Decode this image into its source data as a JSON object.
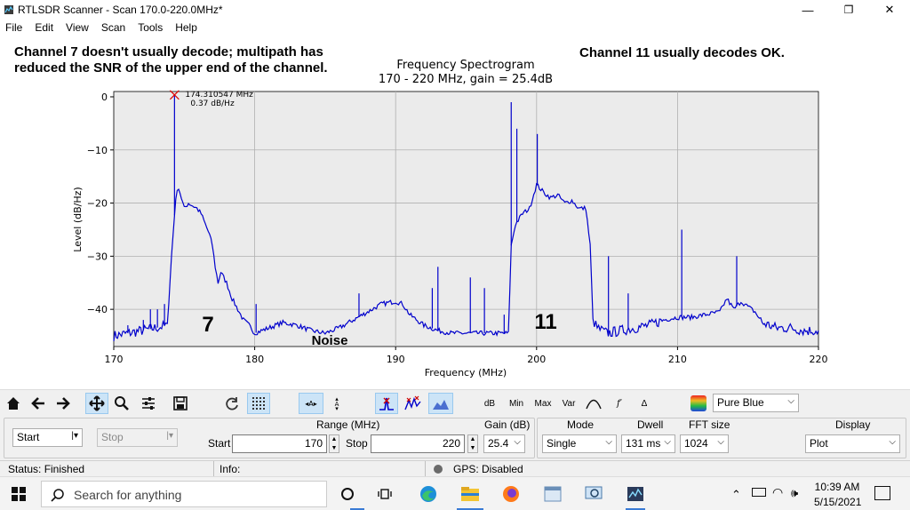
{
  "window": {
    "title": "RTLSDR Scanner - Scan 170.0-220.0MHz*",
    "minimize": "—",
    "maximize": "❐",
    "close": "✕"
  },
  "menu": [
    "File",
    "Edit",
    "View",
    "Scan",
    "Tools",
    "Help"
  ],
  "annotations": {
    "left_line1": "Channel 7 doesn't usually decode; multipath has",
    "left_line2": "reduced the SNR of the upper end of the channel.",
    "right": "Channel 11 usually decodes OK.",
    "ch7": "7",
    "ch11": "11",
    "noise": "Noise"
  },
  "chart_data": {
    "type": "line",
    "title": "Frequency Spectrogram",
    "subtitle": "170 - 220 MHz, gain = 25.4dB",
    "xlabel": "Frequency (MHz)",
    "ylabel": "Level (dB/Hz)",
    "xlim": [
      170,
      220
    ],
    "ylim": [
      -47,
      1
    ],
    "xticks": [
      "170",
      "180",
      "190",
      "200",
      "210",
      "220"
    ],
    "yticks": [
      "0",
      "−10",
      "−20",
      "−30",
      "−40"
    ],
    "grid": true,
    "color": "#0000cc",
    "marker": {
      "x": 174.310547,
      "y": 0.37,
      "label1": "174.310547 MHz",
      "label2": "0.37 dB/Hz"
    },
    "x": [
      170,
      171,
      172,
      173,
      173.8,
      174.1,
      174.4,
      174.6,
      174.8,
      175,
      175.3,
      175.6,
      175.9,
      176.2,
      176.5,
      176.8,
      177,
      177.2,
      177.4,
      177.6,
      178,
      178.4,
      178.8,
      179.2,
      179.6,
      180,
      181,
      182,
      183,
      184,
      185,
      186,
      187,
      188,
      189,
      190,
      190.5,
      191,
      192,
      193,
      194,
      195,
      196,
      197,
      198,
      198.2,
      198.5,
      199,
      199.5,
      200,
      200.5,
      201,
      201.5,
      202,
      202.5,
      203,
      203.5,
      203.8,
      204,
      204.3,
      205,
      206,
      207,
      208,
      209,
      210,
      211,
      212,
      213,
      213.5,
      214,
      214.5,
      215,
      215.5,
      216,
      217,
      218,
      219,
      220
    ],
    "y": [
      -45,
      -44.5,
      -44,
      -43.5,
      -43,
      -30,
      -19,
      -17,
      -19,
      -21,
      -20,
      -20.5,
      -21,
      -22,
      -24,
      -26,
      -28,
      -32,
      -35,
      -33,
      -35,
      -38,
      -40,
      -42,
      -43,
      -44.5,
      -43.5,
      -42.5,
      -43,
      -44,
      -44.5,
      -43.5,
      -42,
      -40.5,
      -39,
      -38.5,
      -39,
      -41,
      -43,
      -44,
      -44.5,
      -44.5,
      -44.5,
      -44.5,
      -44.5,
      -28,
      -24,
      -22,
      -21,
      -16.5,
      -18,
      -19,
      -18.5,
      -20,
      -19.5,
      -21,
      -21,
      -28,
      -42,
      -43.5,
      -44.5,
      -44,
      -43.5,
      -43,
      -42,
      -41.5,
      -41.5,
      -41,
      -40.5,
      -38,
      -40,
      -38.5,
      -39.5,
      -40.5,
      -42.5,
      -43.5,
      -43.5,
      -44,
      -44
    ],
    "spikes": [
      {
        "x": 171,
        "y": -43
      },
      {
        "x": 172.1,
        "y": -42
      },
      {
        "x": 172.6,
        "y": -40
      },
      {
        "x": 173.1,
        "y": -40
      },
      {
        "x": 173.6,
        "y": -39
      },
      {
        "x": 174.31,
        "y": 0.37
      },
      {
        "x": 180.1,
        "y": -39
      },
      {
        "x": 187.4,
        "y": -37
      },
      {
        "x": 192.6,
        "y": -36
      },
      {
        "x": 193,
        "y": -32
      },
      {
        "x": 195.3,
        "y": -34
      },
      {
        "x": 196.3,
        "y": -36
      },
      {
        "x": 197.7,
        "y": -41
      },
      {
        "x": 198.2,
        "y": -1
      },
      {
        "x": 198.6,
        "y": -6
      },
      {
        "x": 200.05,
        "y": -7
      },
      {
        "x": 205.1,
        "y": -30
      },
      {
        "x": 206.5,
        "y": -37
      },
      {
        "x": 210.3,
        "y": -25
      },
      {
        "x": 214.2,
        "y": -30
      }
    ]
  },
  "toolbar": {
    "db": "dB",
    "min": "Min",
    "max": "Max",
    "var": "Var",
    "fprime": "f′",
    "delta": "Δ",
    "colormap": "Pure Blue"
  },
  "controls": {
    "start_button": "Start",
    "stop_button": "Stop",
    "range_label": "Range (MHz)",
    "start_label": "Start",
    "start_value": "170",
    "stop_label": "Stop",
    "stop_value": "220",
    "gain_label": "Gain (dB)",
    "gain_value": "25.4",
    "mode_label": "Mode",
    "mode_value": "Single",
    "dwell_label": "Dwell",
    "dwell_value": "131 ms",
    "fft_label": "FFT size",
    "fft_value": "1024",
    "display_label": "Display",
    "display_value": "Plot"
  },
  "status": {
    "state": "Status: Finished",
    "info": "Info:",
    "gps": "GPS: Disabled"
  },
  "taskbar": {
    "search": "Search for anything",
    "time": "10:39 AM",
    "date": "5/15/2021"
  }
}
